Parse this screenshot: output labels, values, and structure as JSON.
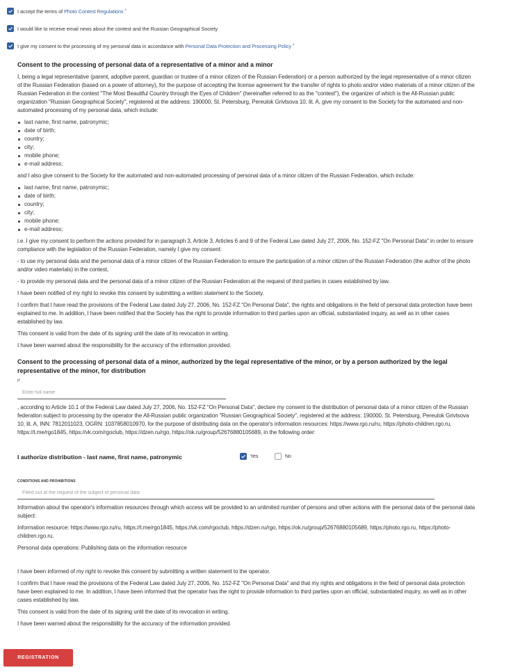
{
  "checkboxes": [
    {
      "prefix": "I accept the terms of ",
      "link": "Photo Contest Regulations",
      "required": "*",
      "checked": true
    },
    {
      "prefix": "I would like to receive email news about the contest and the Russian Geographical Society",
      "link": "",
      "required": "",
      "checked": true
    },
    {
      "prefix": "I give my consent to the processing of my personal data in accordance with ",
      "link": "Personal Data Protection and Processing Policy",
      "required": "*",
      "checked": true
    }
  ],
  "section1": {
    "title": "Consent to the processing of personal data of a representative of a minor and a minor",
    "intro": "I, being a legal representative (parent, adoptive parent, guardian or trustee of a minor citizen of the Russian Federation) or a person authorized by the legal representative of a minor citizen of the Russian Federation (based on a power of attorney), for the purpose of accepting the license agreement for the transfer of rights to photo and/or video materials of a minor citizen of the Russian Federation in the contest \"The Most Beautiful Country through the Eyes of Children\" (hereinafter referred to as the \"contest\"), the organizer of which is the All-Russian public organization \"Russian Geographical Society\", registered at the address: 190000, St. Petersburg, Pereulok Grivtsova 10, lit. A, give my consent to the Society for the automated and non-automated processing of my personal data, which include:",
    "list1": [
      "last name, first name, patronymic;",
      "date of birth;",
      "country;",
      "city;",
      "mobile phone;",
      "e-mail address;"
    ],
    "also": "and I also give consent to the Society for the automated and non-automated processing of personal data of a minor citizen of the Russian Federation, which include:",
    "list2": [
      "last name, first name, patronymic;",
      "date of birth;",
      "country;",
      "city;",
      "mobile phone;",
      "e-mail address;"
    ],
    "ie": "i.e. I give my consent to perform the actions provided for in paragraph 3, Article 3, Articles 6 and 9 of the Federal Law dated July 27, 2006, No. 152-FZ \"On Personal Data\" in order to ensure compliance with the legislation of the Russian Federation, namely I give my consent:",
    "use": "- to use my personal data and the personal data of a minor citizen of the Russian Federation to ensure the participation of a minor citizen of the Russian Federation (the author of the photo and/or video materials) in the contest,",
    "provide": "- to provide my personal data and the personal data of a minor citizen of the Russian Federation at the request of third parties in cases established by law.",
    "notified": "I have been notified of my right to revoke this consent by submitting a written statement to the Society.",
    "confirm": "I confirm that I have read the provisions of the Federal Law dated July 27, 2006, No. 152-FZ \"On Personal Data\", the rights and obligations in the field of personal data protection have been explained to me. In addition, I have been notified that the Society has the right to provide information to third parties upon an official, substantiated inquiry, as well as in other cases established by law.",
    "valid": "This consent is valid from the date of its signing until the date of its revocation in writing.",
    "warned": "I have been warned about the responsibility for the accuracy of the information provided."
  },
  "section2": {
    "title": "Consent to the processing of personal data of a minor, authorized by the legal representative of the minor, or by a person authorized by the legal representative of the minor, for distribution",
    "i_label": "I",
    "i_required": "*",
    "name_placeholder": "Enter full name",
    "declare": ", according to Article 10.1 of the Federal Law dated July 27, 2006, No. 152-FZ \"On Personal Data\", declare my consent to the distribution of personal data of a minor citizen of the Russian federation subject to processing by the operator the All-Russian public organization \"Russian Geographical Society\", registered at the address: 190000, St. Petersburg, Pereulok Grivtsova 10, lit. A, INN: 7812011023, OGRN: 1037858010970, for the purpose of distributing data on the operator's information resources: https://www.rgo.ru/ru, https://photo-children.rgo.ru, https://t.me/rgo1845, https://vk.com/rgoclub, https://dzen.ru/rgo, https://ok.ru/group/52676880105689, in the following order:",
    "authorize_label": "I authorize distribution - last name, first name, patronymic",
    "yes_label": "Yes",
    "no_label": "No",
    "yes_checked": true,
    "no_checked": false,
    "conditions_label": "CONDITIONS AND PROHIBITIONS",
    "conditions_placeholder": "Filled out at the request of the subject of personal data",
    "info_about": "Information about the operator's information resources through which access will be provided to an unlimited number of persons and other actions with the personal data of the personal data subject:",
    "info_resource": "Information resource: https://www.rgo.ru/ru, https://t.me/rgo1845, https://vk.com/rgoclub, https://dzen.ru/rgo, https://ok.ru/group/52676880105689, https://photo.rgo.ru, https://photo-children.rgo.ru.",
    "operations": "Personal data operations: Publishing data on the information resource",
    "informed": "I have been informed of my right to revoke this consent by submitting a written statement to the operator.",
    "confirm": "I confirm that I have read the provisions of the Federal Law dated July 27, 2006, No. 152-FZ \"On Personal Data\" and that my rights and obligations in the field of personal data protection have been explained to me. In addition, I have been informed that the operator has the right to provide information to third parties upon an official, substantiated inquiry, as well as in other cases established by law.",
    "valid": "This consent is valid from the date of its signing until the date of its revocation in writing.",
    "warned": "I have been warned about the responsibility for the accuracy of the information provided."
  },
  "registration_button": "REGISTRATION",
  "colors": {
    "accent": "#2f5f9e",
    "button": "#d6403f"
  }
}
